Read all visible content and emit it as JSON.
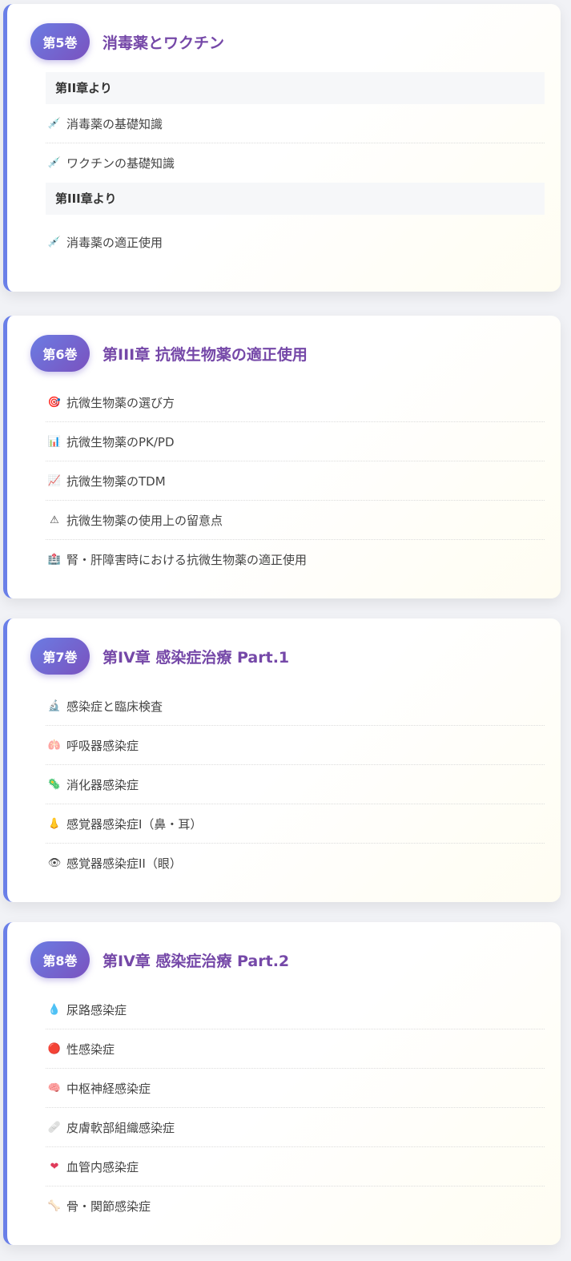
{
  "volumes": [
    {
      "badge": "第5巻",
      "title": "消毒薬とワクチン",
      "groups": [
        {
          "heading": "第II章より",
          "items": [
            {
              "icon": "syringe-icon",
              "glyph": "💉",
              "label": "消毒薬の基礎知識"
            },
            {
              "icon": "syringe-icon",
              "glyph": "💉",
              "label": "ワクチンの基礎知識"
            }
          ]
        },
        {
          "heading": "第III章より",
          "items": [
            {
              "icon": "syringe-icon",
              "glyph": "💉",
              "label": "消毒薬の適正使用"
            }
          ]
        }
      ]
    },
    {
      "badge": "第6巻",
      "title": "第III章 抗微生物薬の適正使用",
      "items": [
        {
          "icon": "target-icon",
          "glyph": "🎯",
          "label": "抗微生物薬の選び方"
        },
        {
          "icon": "bar-chart-icon",
          "glyph": "📊",
          "label": "抗微生物薬のPK/PD"
        },
        {
          "icon": "line-chart-icon",
          "glyph": "📈",
          "label": "抗微生物薬のTDM"
        },
        {
          "icon": "warning-icon",
          "glyph": "⚠",
          "label": "抗微生物薬の使用上の留意点"
        },
        {
          "icon": "hospital-icon",
          "glyph": "🏥",
          "label": "腎・肝障害時における抗微生物薬の適正使用"
        }
      ]
    },
    {
      "badge": "第7巻",
      "title": "第IV章 感染症治療 Part.1",
      "items": [
        {
          "icon": "microscope-icon",
          "glyph": "🔬",
          "label": "感染症と臨床検査"
        },
        {
          "icon": "lungs-icon",
          "glyph": "🫁",
          "label": "呼吸器感染症"
        },
        {
          "icon": "microbe-icon",
          "glyph": "🦠",
          "label": "消化器感染症"
        },
        {
          "icon": "nose-icon",
          "glyph": "👃",
          "label": "感覚器感染症I（鼻・耳）"
        },
        {
          "icon": "eye-icon",
          "glyph": "👁",
          "label": "感覚器感染症II（眼）"
        }
      ]
    },
    {
      "badge": "第8巻",
      "title": "第IV章 感染症治療 Part.2",
      "items": [
        {
          "icon": "droplet-icon",
          "glyph": "💧",
          "label": "尿路感染症"
        },
        {
          "icon": "red-circle-icon",
          "glyph": "🔴",
          "label": "性感染症"
        },
        {
          "icon": "brain-icon",
          "glyph": "🧠",
          "label": "中枢神経感染症"
        },
        {
          "icon": "bandage-icon",
          "glyph": "🩹",
          "label": "皮膚軟部組織感染症"
        },
        {
          "icon": "heart-icon",
          "glyph": "❤",
          "label": "血管内感染症"
        },
        {
          "icon": "bone-icon",
          "glyph": "🦴",
          "label": "骨・関節感染症"
        }
      ]
    }
  ]
}
